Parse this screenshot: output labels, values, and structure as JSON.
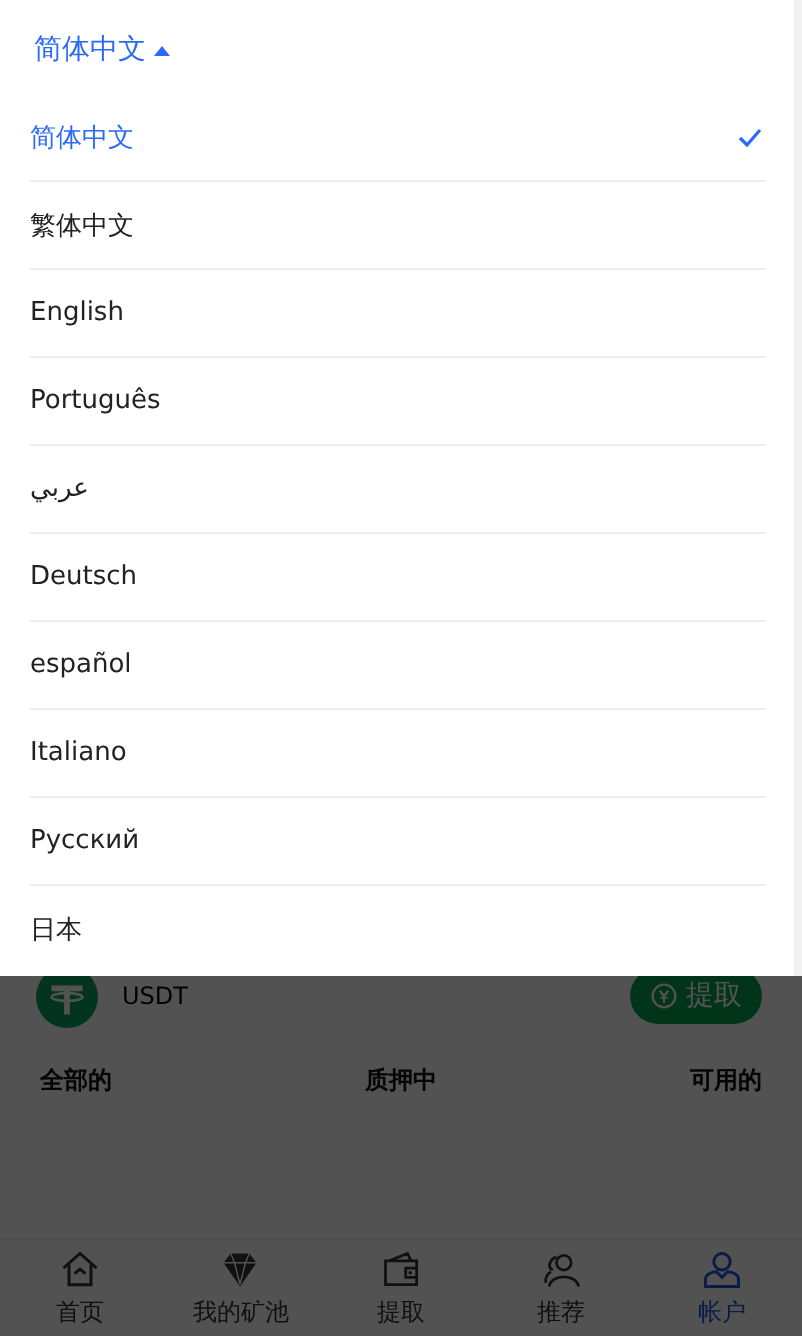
{
  "language_menu": {
    "current": "简体中文",
    "expanded": true,
    "options": [
      {
        "label": "简体中文",
        "selected": true
      },
      {
        "label": "繁体中文",
        "selected": false
      },
      {
        "label": "English",
        "selected": false
      },
      {
        "label": "Português",
        "selected": false
      },
      {
        "label": "عربي",
        "selected": false
      },
      {
        "label": "Deutsch",
        "selected": false
      },
      {
        "label": "español",
        "selected": false
      },
      {
        "label": "Italiano",
        "selected": false
      },
      {
        "label": "Русский",
        "selected": false
      },
      {
        "label": "日本",
        "selected": false
      }
    ]
  },
  "asset": {
    "symbol": "USDT",
    "action": "提取"
  },
  "balance_headers": [
    "全部的",
    "质押中",
    "可用的"
  ],
  "tab_bar": [
    {
      "label": "首页",
      "selected": false
    },
    {
      "label": "我的矿池",
      "selected": false
    },
    {
      "label": "提取",
      "selected": false
    },
    {
      "label": "推荐",
      "selected": false
    },
    {
      "label": "帐户",
      "selected": true
    }
  ]
}
